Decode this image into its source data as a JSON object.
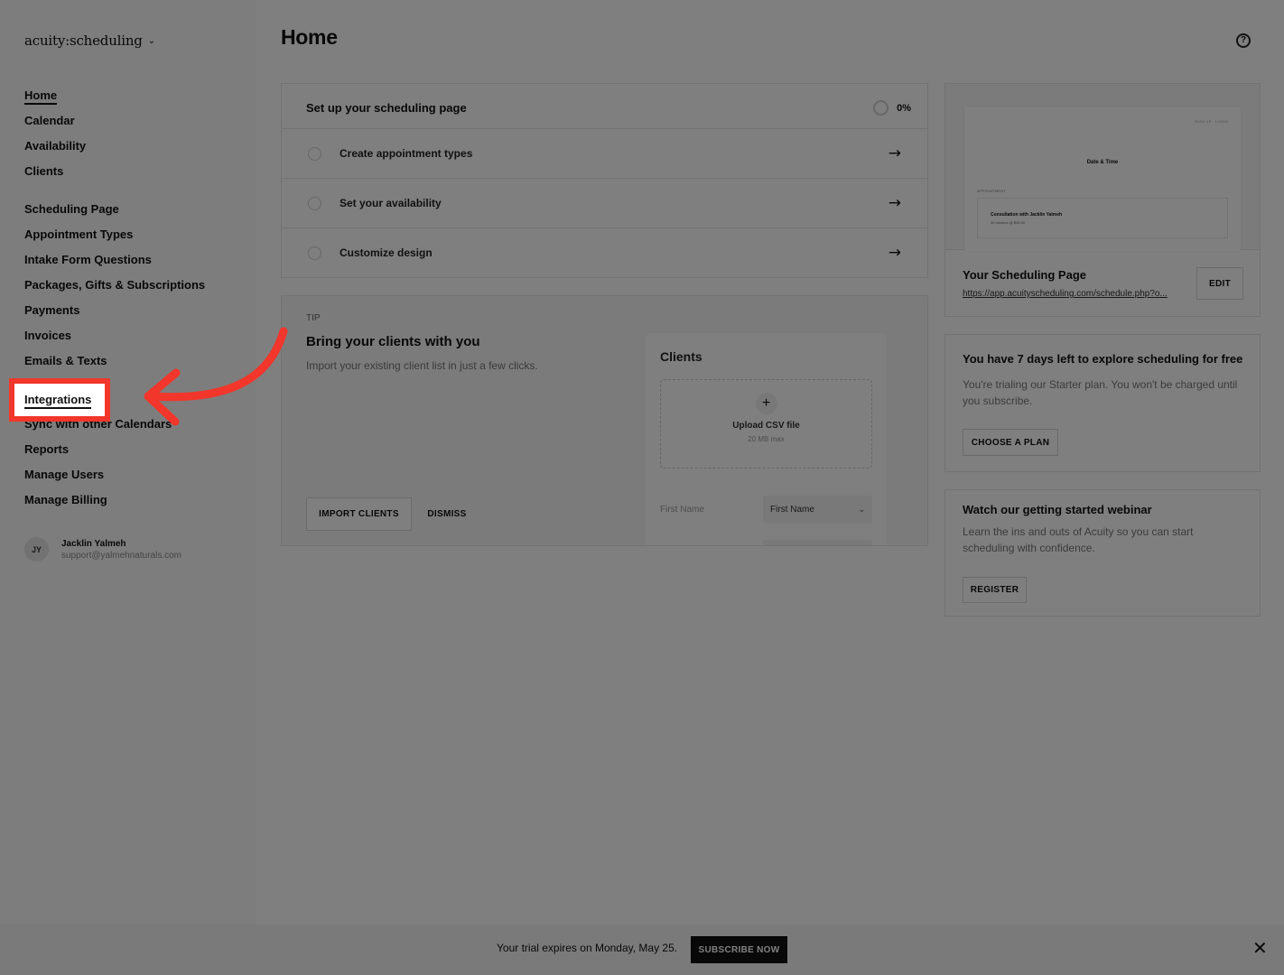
{
  "app": {
    "logo": "acuity:scheduling",
    "logo_chevron": "⌄"
  },
  "sidebar": {
    "items": [
      {
        "id": "home",
        "label": "Home"
      },
      {
        "id": "calendar",
        "label": "Calendar"
      },
      {
        "id": "availability",
        "label": "Availability"
      },
      {
        "id": "clients",
        "label": "Clients"
      },
      {
        "id": "scheduling-page",
        "label": "Scheduling Page"
      },
      {
        "id": "appointment-types",
        "label": "Appointment Types"
      },
      {
        "id": "intake-form-questions",
        "label": "Intake Form Questions"
      },
      {
        "id": "packages",
        "label": "Packages, Gifts & Subscriptions"
      },
      {
        "id": "payments",
        "label": "Payments"
      },
      {
        "id": "invoices",
        "label": "Invoices"
      },
      {
        "id": "emails-texts",
        "label": "Emails & Texts"
      },
      {
        "id": "integrations",
        "label": "Integrations"
      },
      {
        "id": "sync-calendars",
        "label": "Sync with other Calendars"
      },
      {
        "id": "reports",
        "label": "Reports"
      },
      {
        "id": "manage-users",
        "label": "Manage Users"
      },
      {
        "id": "manage-billing",
        "label": "Manage Billing"
      }
    ],
    "user": {
      "initials": "JY",
      "name": "Jacklin Yalmeh",
      "email": "support@yalmehnaturals.com"
    }
  },
  "main": {
    "title": "Home",
    "setup": {
      "title": "Set up your scheduling page",
      "progress": "0%",
      "tasks": [
        {
          "label": "Create appointment types"
        },
        {
          "label": "Set your availability"
        },
        {
          "label": "Customize design"
        }
      ],
      "arrow": "→"
    },
    "tip": {
      "label": "TIP",
      "title": "Bring your clients with you",
      "description": "Import your existing client list in just a few clicks.",
      "import_button": "IMPORT CLIENTS",
      "dismiss_button": "DISMISS",
      "panel": {
        "title": "Clients",
        "plus": "+",
        "upload_label": "Upload CSV file",
        "upload_sub": "20 MB max",
        "field_label": "First Name",
        "field_value": "First Name",
        "dropdown_icon": "⌄"
      }
    }
  },
  "right": {
    "preview": {
      "top_links": "SIGN UP · LOGIN",
      "date_time": "Date & Time",
      "appointment_label": "APPOINTMENT",
      "consult": "Consultation with Jacklin Yalmeh",
      "duration": "30 minutes @ $45.00"
    },
    "scheduling_page": {
      "title": "Your Scheduling Page",
      "link": "https://app.acuityscheduling.com/schedule.php?o...",
      "edit_button": "EDIT"
    },
    "trial": {
      "title": "You have 7 days left to explore scheduling for free",
      "description": "You're trialing our Starter plan. You won't be charged until you subscribe.",
      "button": "CHOOSE A PLAN"
    },
    "webinar": {
      "title": "Watch our getting started webinar",
      "description": "Learn the ins and outs of Acuity so you can start scheduling with confidence.",
      "button": "REGISTER"
    }
  },
  "trial_bar": {
    "text": "Your trial expires on Monday, May 25.",
    "button": "SUBSCRIBE NOW",
    "close": "✕"
  },
  "help_icon": "?",
  "colors": {
    "highlight": "#f2362b",
    "overlay": "rgba(0,0,0,0.5)"
  }
}
